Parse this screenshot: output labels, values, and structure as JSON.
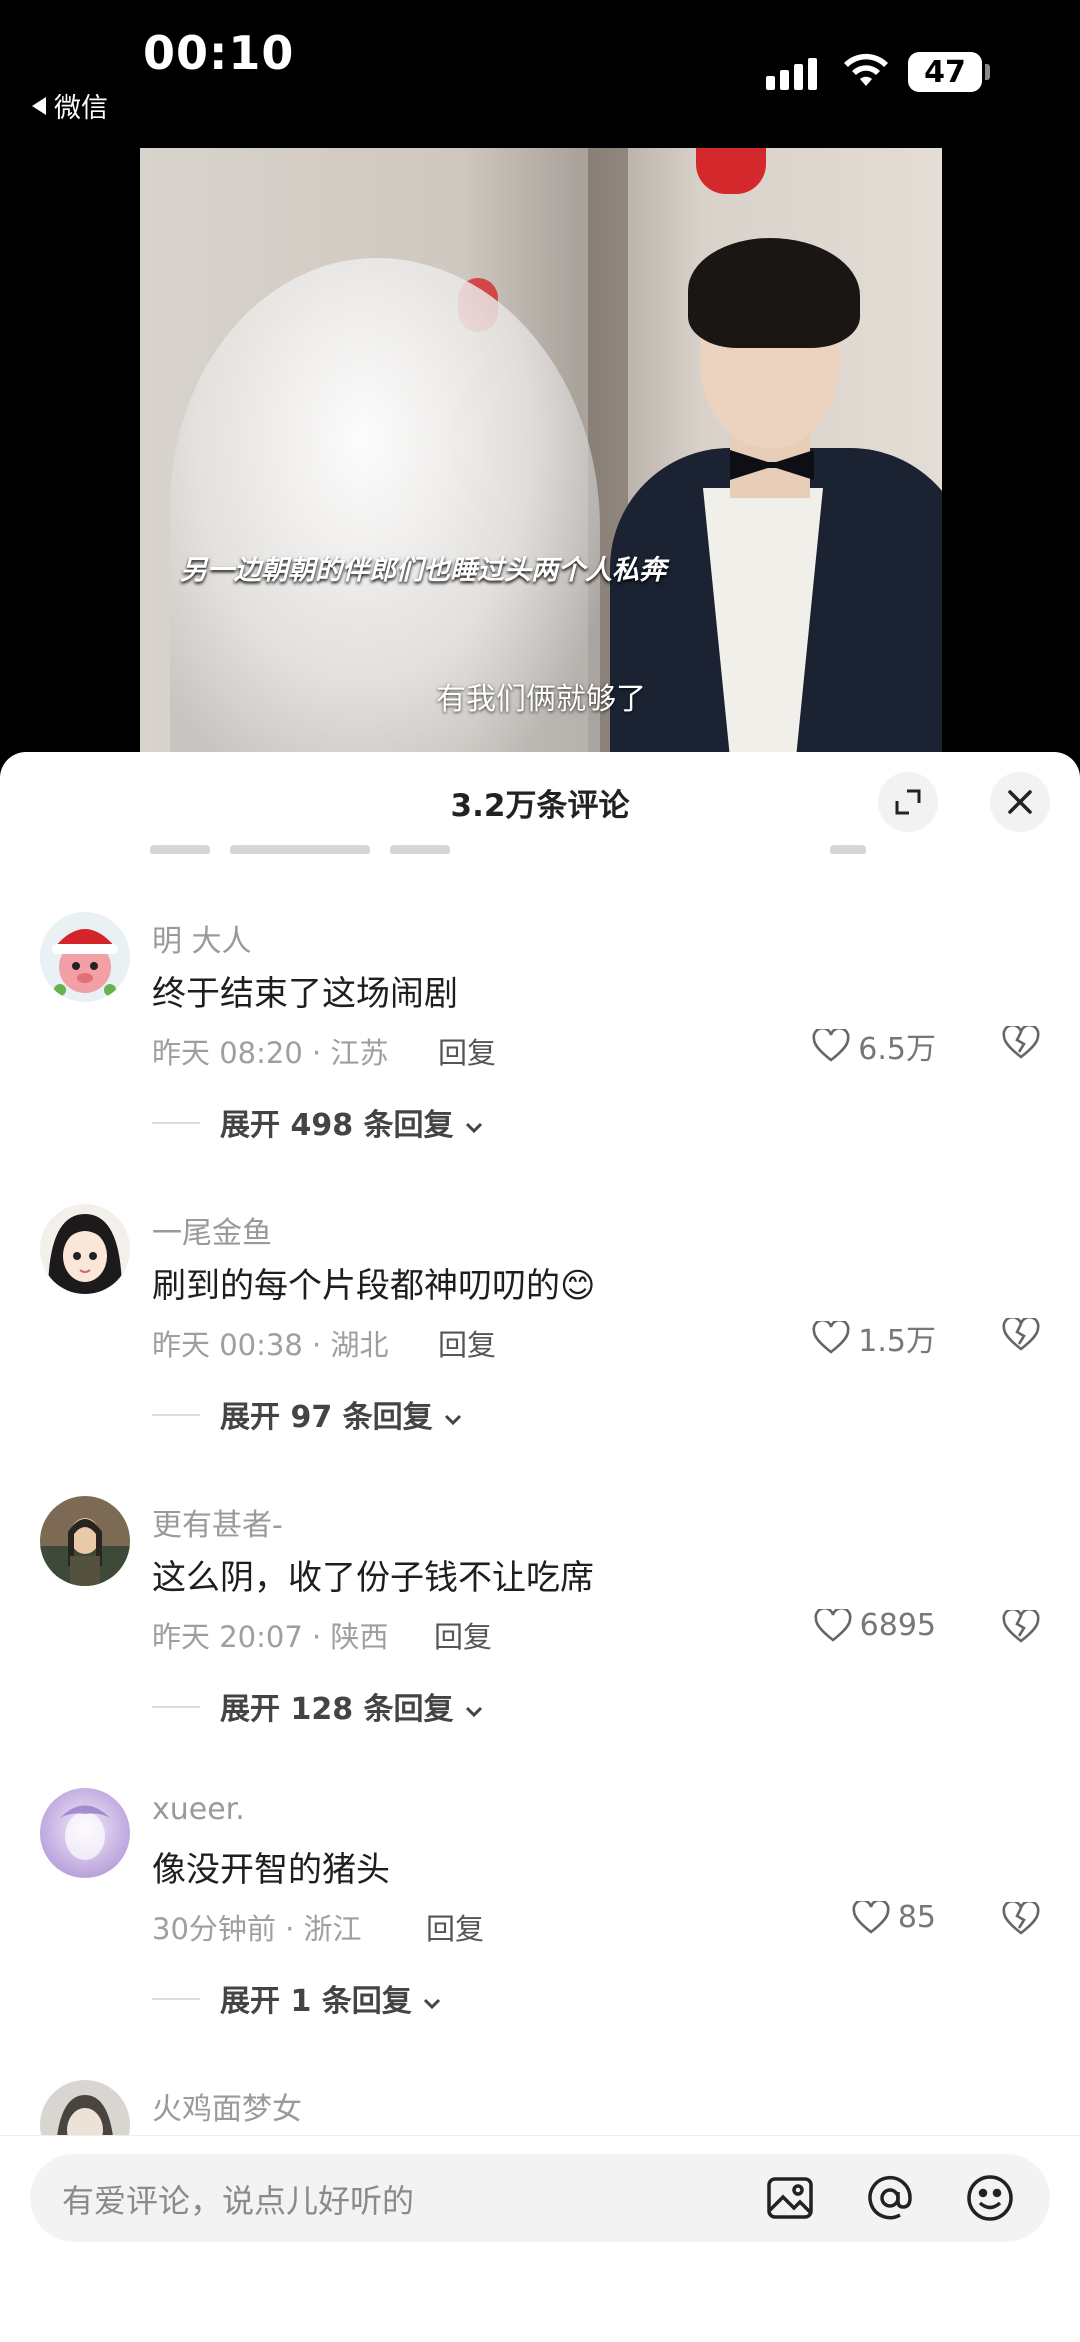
{
  "status": {
    "time": "00:10",
    "back_app": "微信",
    "battery": "47"
  },
  "video": {
    "subtitle_top": "另一边朝朝的伴郎们也睡过头两个人私奔",
    "subtitle_bottom": "有我们俩就够了"
  },
  "sheet": {
    "title": "3.2万条评论"
  },
  "comments": [
    {
      "name": "明 大人",
      "text": "终于结束了这场闹剧",
      "meta": "昨天 08:20 · 江苏",
      "reply": "回复",
      "likes": "6.5万",
      "expand": "展开 498 条回复"
    },
    {
      "name": "一尾金鱼",
      "text": "刷到的每个片段都神叨叨的",
      "emoji": "😊",
      "meta": "昨天 00:38 · 湖北",
      "reply": "回复",
      "likes": "1.5万",
      "expand": "展开 97 条回复"
    },
    {
      "name": "更有甚者-",
      "text": "这么阴，收了份子钱不让吃席",
      "meta": "昨天 20:07 · 陕西",
      "reply": "回复",
      "likes": "6895",
      "expand": "展开 128 条回复"
    },
    {
      "name": "xueer.",
      "text": "像没开智的猪头",
      "meta": "30分钟前 · 浙江",
      "reply": "回复",
      "likes": "85",
      "expand": "展开 1 条回复"
    },
    {
      "name": "火鸡面梦女"
    }
  ],
  "input": {
    "placeholder": "有爱评论，说点儿好听的"
  },
  "colors": {
    "like_gray": "#777777",
    "sheet_bg": "#ffffff",
    "input_bg": "#f3f3f3"
  },
  "icons": [
    "back-arrow-icon",
    "signal-icon",
    "wifi-icon",
    "battery-icon",
    "expand-icon",
    "close-icon",
    "heart-icon",
    "broken-heart-icon",
    "chevron-down-icon",
    "image-icon",
    "at-icon",
    "emoji-icon"
  ]
}
